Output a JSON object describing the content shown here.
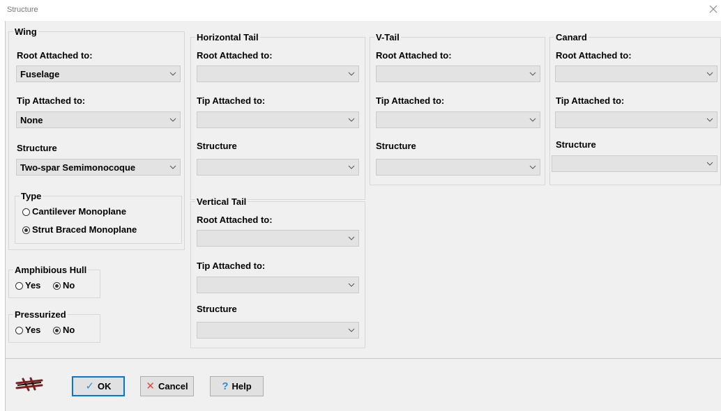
{
  "window": {
    "title": "Structure"
  },
  "wing": {
    "legend": "Wing",
    "root_label": "Root Attached to:",
    "root_value": "Fuselage",
    "tip_label": "Tip Attached to:",
    "tip_value": "None",
    "structure_label": "Structure",
    "structure_value": "Two-spar Semimonocoque",
    "type": {
      "legend": "Type",
      "options": [
        "Cantilever Monoplane",
        "Strut Braced Monoplane"
      ],
      "selected": "Strut Braced Monoplane"
    }
  },
  "horizontal_tail": {
    "legend": "Horizontal Tail",
    "root_label": "Root Attached to:",
    "tip_label": "Tip Attached to:",
    "structure_label": "Structure"
  },
  "v_tail": {
    "legend": "V-Tail",
    "root_label": "Root Attached to:",
    "tip_label": "Tip Attached to:",
    "structure_label": "Structure"
  },
  "canard": {
    "legend": "Canard",
    "root_label": "Root Attached to:",
    "tip_label": "Tip Attached to:",
    "structure_label": "Structure"
  },
  "vertical_tail": {
    "legend": "Vertical Tail",
    "root_label": "Root Attached to:",
    "tip_label": "Tip Attached to:",
    "structure_label": "Structure"
  },
  "amphibious_hull": {
    "legend": "Amphibious Hull",
    "yes": "Yes",
    "no": "No",
    "selected": "No"
  },
  "pressurized": {
    "legend": "Pressurized",
    "yes": "Yes",
    "no": "No",
    "selected": "No"
  },
  "buttons": {
    "ok": "OK",
    "cancel": "Cancel",
    "help": "Help"
  },
  "icons": {
    "ok": "checkmark-icon",
    "cancel": "x-icon",
    "help": "question-icon",
    "logo": "airplane-structure-icon",
    "close": "close-icon",
    "dropdown": "chevron-down-icon"
  },
  "colors": {
    "ok_check": "#2a8fd8",
    "cancel_x": "#e04b3a",
    "help_q": "#2a8fd8",
    "logo": "#7b1f1f",
    "focus_border": "#0078d7"
  }
}
